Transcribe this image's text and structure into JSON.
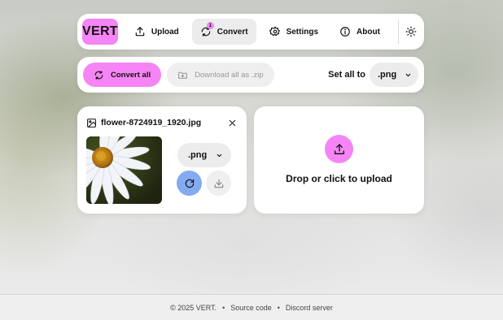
{
  "app": {
    "logo": "VERT"
  },
  "nav": {
    "upload": "Upload",
    "convert": "Convert",
    "convert_badge": "1",
    "settings": "Settings",
    "about": "About"
  },
  "toolbar": {
    "convert_all": "Convert all",
    "download_zip": "Download all as .zip",
    "set_all_label": "Set all to",
    "set_all_value": ".png"
  },
  "file": {
    "name": "flower-8724919_1920.jpg",
    "target_format": ".png"
  },
  "upload": {
    "text": "Drop or click to upload"
  },
  "footer": {
    "copyright": "© 2025 VERT.",
    "sep1": "•",
    "source": "Source code",
    "sep2": "•",
    "discord": "Discord server"
  },
  "colors": {
    "accent_pink": "#f585f4",
    "accent_blue": "#84aaf0"
  }
}
